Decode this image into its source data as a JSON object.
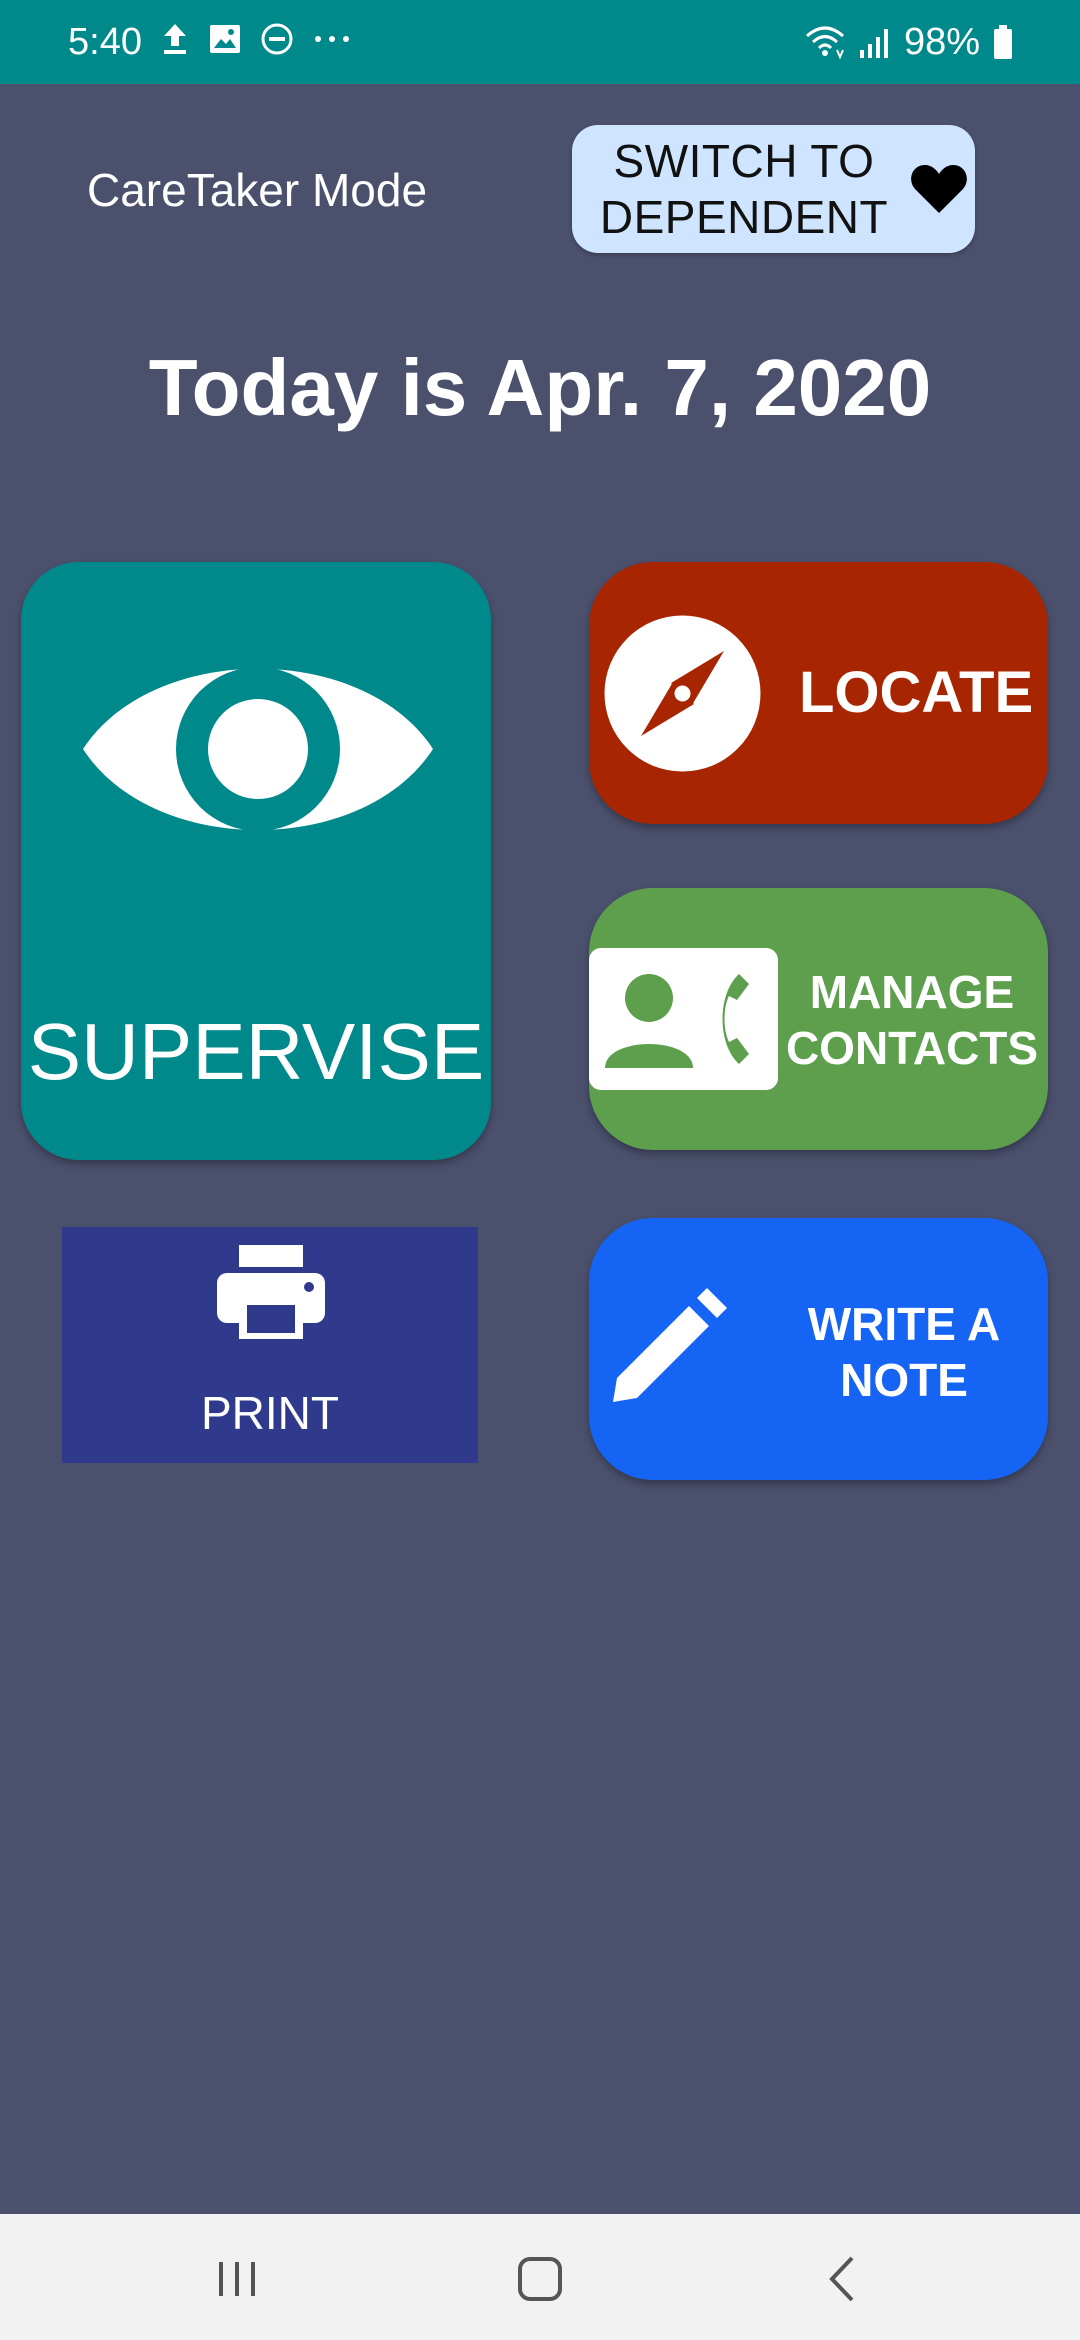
{
  "status_bar": {
    "time": "5:40",
    "left_icons": [
      "upload-icon",
      "image-icon",
      "do-not-disturb-icon",
      "more-icon"
    ],
    "right_icons": [
      "wifi-icon",
      "signal-icon",
      "battery-icon"
    ],
    "battery": "98%"
  },
  "header": {
    "mode_label": "CareTaker Mode",
    "switch_label": "SWITCH TO DEPENDENT",
    "switch_icon": "heart-icon"
  },
  "date_title": "Today is Apr. 7, 2020",
  "tiles": {
    "supervise": {
      "label": "SUPERVISE",
      "icon": "eye-icon",
      "color": "#00898a"
    },
    "locate": {
      "label": "LOCATE",
      "icon": "compass-icon",
      "color": "#a82502"
    },
    "contacts": {
      "label": "MANAGE CONTACTS",
      "icon": "contact-phone-icon",
      "color": "#5e9f4e"
    },
    "print": {
      "label": "PRINT",
      "icon": "printer-icon",
      "color": "#303a8c"
    },
    "note": {
      "label": "WRITE A NOTE",
      "icon": "pencil-icon",
      "color": "#1664f3"
    }
  },
  "nav_bar": {
    "buttons": [
      "recent-apps-icon",
      "home-icon",
      "back-icon"
    ]
  },
  "colors": {
    "status_bar": "#00898a",
    "background": "#4b506d",
    "switch_button": "#cfe5ff"
  }
}
